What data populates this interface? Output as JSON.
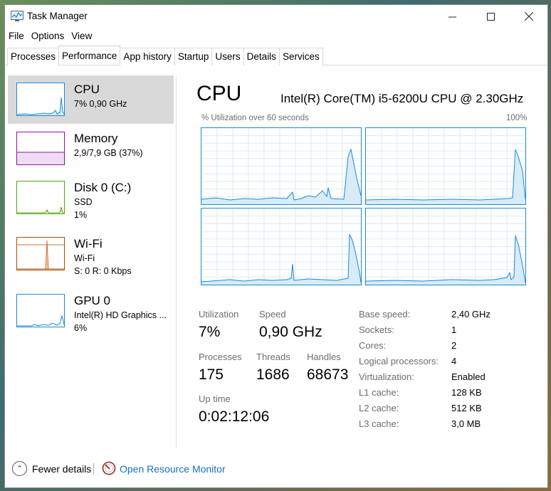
{
  "window": {
    "title": "Task Manager"
  },
  "menu": [
    "File",
    "Options",
    "View"
  ],
  "tabs": [
    "Processes",
    "Performance",
    "App history",
    "Startup",
    "Users",
    "Details",
    "Services"
  ],
  "sidebar": {
    "items": [
      {
        "name": "CPU",
        "line1": "7% 0,90 GHz",
        "color": "#1a8ad4"
      },
      {
        "name": "Memory",
        "line1": "2,9/7,9 GB (37%)",
        "color": "#8b12ae"
      },
      {
        "name": "Disk 0 (C:)",
        "line1": "SSD",
        "line2": "1%",
        "color": "#4da60c"
      },
      {
        "name": "Wi-Fi",
        "line1": "Wi-Fi",
        "line2": "S: 0 R: 0 Kbps",
        "color": "#a74f01"
      },
      {
        "name": "GPU 0",
        "line1": "Intel(R) HD Graphics ...",
        "line2": "6%",
        "color": "#1a8ad4"
      }
    ]
  },
  "main": {
    "title": "CPU",
    "model": "Intel(R) Core(TM) i5-6200U CPU @ 2.30GHz",
    "graph_caption": "% Utilization over 60 seconds",
    "graph_max": "100%",
    "stats": {
      "utilization_label": "Utilization",
      "utilization": "7%",
      "speed_label": "Speed",
      "speed": "0,90 GHz",
      "processes_label": "Processes",
      "processes": "175",
      "threads_label": "Threads",
      "threads": "1686",
      "handles_label": "Handles",
      "handles": "68673",
      "uptime_label": "Up time",
      "uptime": "0:02:12:06"
    },
    "specs": [
      {
        "key": "Base speed:",
        "value": "2,40 GHz"
      },
      {
        "key": "Sockets:",
        "value": "1"
      },
      {
        "key": "Cores:",
        "value": "2"
      },
      {
        "key": "Logical processors:",
        "value": "4"
      },
      {
        "key": "Virtualization:",
        "value": "Enabled"
      },
      {
        "key": "L1 cache:",
        "value": "128 KB"
      },
      {
        "key": "L2 cache:",
        "value": "512 KB"
      },
      {
        "key": "L3 cache:",
        "value": "3,0 MB"
      }
    ]
  },
  "footer": {
    "fewer_details": "Fewer details",
    "open_resource_monitor": "Open Resource Monitor"
  },
  "colors": {
    "accent": "#1a8ad4",
    "link": "#1a6fc4",
    "selected_bg": "#d9d9d9"
  }
}
